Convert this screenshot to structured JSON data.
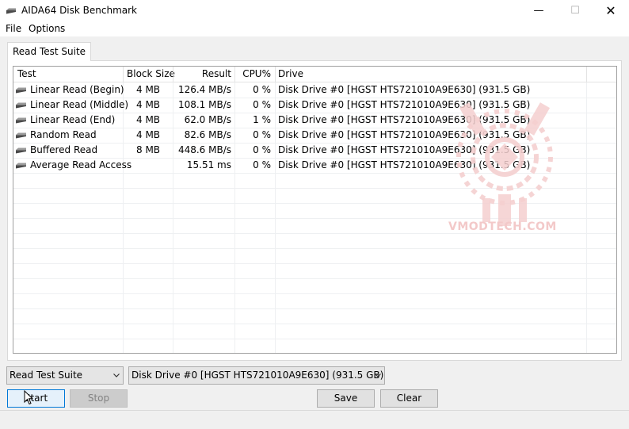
{
  "window": {
    "title": "AIDA64 Disk Benchmark",
    "icon": "disk-icon"
  },
  "window_controls": {
    "minimize": "—",
    "maximize": "☐",
    "close": "✕"
  },
  "menu": {
    "file": "File",
    "options": "Options"
  },
  "tab": {
    "label": "Read Test Suite"
  },
  "table": {
    "headers": {
      "test": "Test",
      "block": "Block Size",
      "result": "Result",
      "cpu": "CPU%",
      "drive": "Drive"
    },
    "rows": [
      {
        "test": "Linear Read (Begin)",
        "block": "4 MB",
        "result": "126.4 MB/s",
        "cpu": "0 %",
        "drive": "Disk Drive #0  [HGST HTS721010A9E630]  (931.5 GB)"
      },
      {
        "test": "Linear Read (Middle)",
        "block": "4 MB",
        "result": "108.1 MB/s",
        "cpu": "0 %",
        "drive": "Disk Drive #0  [HGST HTS721010A9E630]  (931.5 GB)"
      },
      {
        "test": "Linear Read (End)",
        "block": "4 MB",
        "result": "62.0 MB/s",
        "cpu": "1 %",
        "drive": "Disk Drive #0  [HGST HTS721010A9E630]  (931.5 GB)"
      },
      {
        "test": "Random Read",
        "block": "4 MB",
        "result": "82.6 MB/s",
        "cpu": "0 %",
        "drive": "Disk Drive #0  [HGST HTS721010A9E630]  (931.5 GB)"
      },
      {
        "test": "Buffered Read",
        "block": "8 MB",
        "result": "448.6 MB/s",
        "cpu": "0 %",
        "drive": "Disk Drive #0  [HGST HTS721010A9E630]  (931.5 GB)"
      },
      {
        "test": "Average Read Access",
        "block": "",
        "result": "15.51 ms",
        "cpu": "0 %",
        "drive": "Disk Drive #0  [HGST HTS721010A9E630]  (931.5 GB)"
      }
    ]
  },
  "watermark": {
    "text": "VMODTECH.COM",
    "color": "#f3c9c9"
  },
  "controls": {
    "suite_select": "Read Test Suite",
    "drive_select": "Disk Drive #0  [HGST HTS721010A9E630]  (931.5 GB)",
    "start": "Start",
    "stop": "Stop",
    "save": "Save",
    "clear": "Clear"
  },
  "colors": {
    "accent": "#0078d7",
    "grid_line": "#eef0f2",
    "border": "#a0a0a0"
  }
}
